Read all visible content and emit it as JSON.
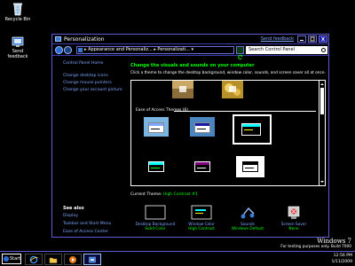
{
  "desktop": {
    "icons": [
      {
        "label": "Recycle Bin",
        "icon": "recycle-bin-icon"
      },
      {
        "label_lines": [
          "Send",
          "feedback"
        ],
        "icon": "feedback-icon"
      }
    ]
  },
  "window": {
    "title": "Personalization",
    "send_feedback": "Send feedback",
    "address": {
      "breadcrumb": "▸  Appearance and Personaliz... ▸ Personalizati...  ▾",
      "search_placeholder": "Search Control Panel"
    },
    "left_pane": {
      "home": "Control Panel Home",
      "links": [
        "Change desktop icons",
        "Change mouse pointers",
        "Change your account picture"
      ],
      "see_also_title": "See also",
      "see_also": [
        "Display",
        "Taskbar and Start Menu",
        "Ease of Access Center"
      ]
    },
    "main": {
      "heading": "Change the visuals and sounds on your computer",
      "subheading": "Click a theme to change the desktop background, window color, sounds, and screen saver all at once.",
      "ease_group_label": "Ease of Access Themes (6)",
      "current_theme_label": "Current Theme:",
      "current_theme_value": "High Contrast #1",
      "bottom_items": [
        {
          "label": "Desktop Background",
          "value": "Solid Color",
          "icon": "desktop-background-icon"
        },
        {
          "label": "Window Color",
          "value": "High Contrast",
          "icon": "window-color-icon"
        },
        {
          "label": "Sounds",
          "value": "Windows Default",
          "icon": "sounds-icon"
        },
        {
          "label": "Screen Saver",
          "value": "None",
          "icon": "screen-saver-icon"
        }
      ]
    }
  },
  "watermark": {
    "title": "Windows 7",
    "line1": "For testing purposes only. Build 7000"
  },
  "taskbar": {
    "start_label": "Start",
    "time": "12:56 PM",
    "date": "1/11/2009"
  },
  "colors": {
    "accent": "#5b5bd6",
    "link": "#7fa6ff",
    "hc_green": "#00ff00"
  }
}
